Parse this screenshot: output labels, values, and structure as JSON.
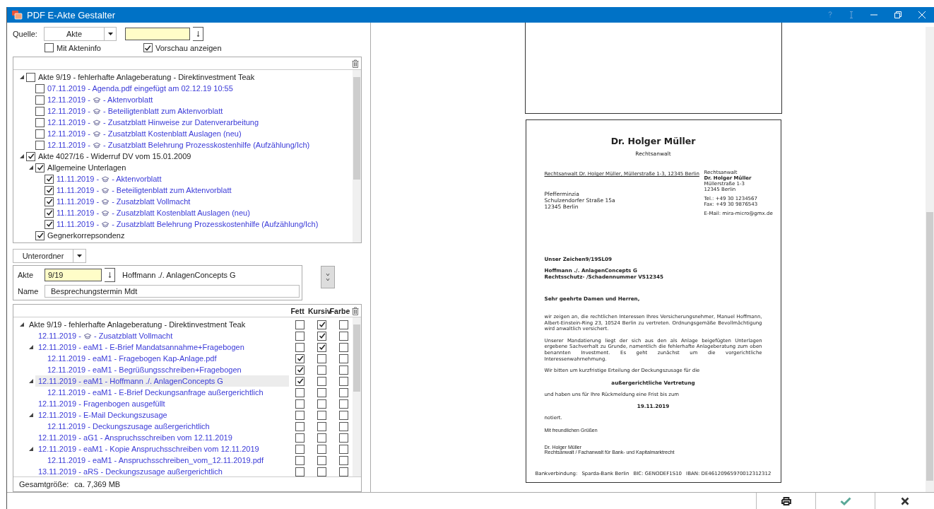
{
  "window": {
    "title": "PDF E-Akte Gestalter"
  },
  "source": {
    "label": "Quelle:",
    "dropdown": "Akte",
    "options": [
      {
        "label": "Mit Akteninfo",
        "checked": false
      },
      {
        "label": "Vorschau anzeigen",
        "checked": true
      }
    ]
  },
  "tree1": {
    "items": [
      {
        "kind": "folder",
        "label": "Akte 9/19 - fehlerhafte Anlageberatung - Direktinvestment Teak",
        "checked": false,
        "expanded": true,
        "children": [
          {
            "kind": "document",
            "label": "07.11.2019 - Agenda.pdf  eingefügt am 02.12.19 10:55",
            "checked": false
          },
          {
            "kind": "document",
            "label": "12.11.2019 -",
            "suffix": "- Aktenvorblatt",
            "checked": false
          },
          {
            "kind": "document",
            "label": "12.11.2019 -",
            "suffix": "- Beteiligtenblatt zum Aktenvorblatt",
            "checked": false
          },
          {
            "kind": "document",
            "label": "12.11.2019 -",
            "suffix": "- Zusatzblatt Hinweise zur Datenverarbeitung",
            "checked": false
          },
          {
            "kind": "document",
            "label": "12.11.2019 -",
            "suffix": "- Zusatzblatt Kostenblatt Auslagen (neu)",
            "checked": false
          },
          {
            "kind": "document",
            "label": "12.11.2019 -",
            "suffix": "- Zusatzblatt Belehrung Prozesskostenhilfe (Aufzählung/Ich)",
            "checked": false
          }
        ]
      },
      {
        "kind": "folder",
        "label": "Akte 4027/16 - Widerruf DV vom 15.01.2009",
        "checked": true,
        "expanded": true,
        "children": [
          {
            "kind": "folder",
            "label": "Allgemeine Unterlagen",
            "checked": true,
            "expanded": true,
            "children": [
              {
                "kind": "document",
                "label": "11.11.2019 -",
                "suffix": "- Aktenvorblatt",
                "checked": true
              },
              {
                "kind": "document",
                "label": "11.11.2019 -",
                "suffix": "- Beteiligtenblatt zum Aktenvorblatt",
                "checked": true
              },
              {
                "kind": "document",
                "label": "11.11.2019 -",
                "suffix": "- Zusatzblatt Vollmacht",
                "checked": true
              },
              {
                "kind": "document",
                "label": "11.11.2019 -",
                "suffix": "- Zusatzblatt Kostenblatt Auslagen (neu)",
                "checked": true
              },
              {
                "kind": "document",
                "label": "11.11.2019 -",
                "suffix": "- Zusatzblatt Belehrung Prozesskostenhilfe (Aufzählung/Ich)",
                "checked": true
              }
            ]
          },
          {
            "kind": "folder",
            "label": "Gegnerkorrepsondenz",
            "checked": true
          }
        ]
      }
    ]
  },
  "subfolder": {
    "dropdown": "Unterordner",
    "akte_label": "Akte",
    "akte_value": "9/19",
    "akte_name": "Hoffmann ./. AnlagenConcepts G",
    "name_label": "Name",
    "name_value": "Besprechungstermin Mdt"
  },
  "tree2": {
    "columns": [
      "Fett",
      "Kursiv",
      "Farbe"
    ],
    "items": [
      {
        "kind": "folder",
        "label": "Akte 9/19 - fehlerhafte Anlageberatung - Direktinvestment Teak",
        "expanded": true,
        "selected": false,
        "fett": false,
        "kursiv": true,
        "farbe": false,
        "children": [
          {
            "kind": "document",
            "label": "12.11.2019 -",
            "suffix": "- Zusatzblatt Vollmacht",
            "selected": false,
            "fett": false,
            "kursiv": true,
            "farbe": false
          },
          {
            "kind": "document",
            "label": "12.11.2019 - eaM1 - E-Brief Mandatsannahme+Fragebogen",
            "expanded": true,
            "selected": false,
            "fett": false,
            "kursiv": true,
            "farbe": false,
            "children": [
              {
                "kind": "document",
                "label": "12.11.2019 - eaM1 - Fragebogen Kap-Anlage.pdf",
                "selected": false,
                "fett": true,
                "kursiv": false,
                "farbe": false
              },
              {
                "kind": "document",
                "label": "12.11.2019 - eaM1 - Begrüßungsschreiben+Fragebogen",
                "selected": false,
                "fett": true,
                "kursiv": false,
                "farbe": false
              }
            ]
          },
          {
            "kind": "document",
            "label": "12.11.2019 - eaM1 - Hoffmann ./. AnlagenConcepts G",
            "expanded": true,
            "selected": true,
            "fett": true,
            "kursiv": false,
            "farbe": false,
            "children": [
              {
                "kind": "document",
                "label": "12.11.2019 - eaM1 - E-Brief Deckungsanfrage außergerichtlich",
                "selected": false,
                "fett": false,
                "kursiv": false,
                "farbe": false
              }
            ]
          },
          {
            "kind": "document",
            "label": "12.11.2019 - Fragenbogen ausgefüllt",
            "selected": false,
            "fett": false,
            "kursiv": false,
            "farbe": false
          },
          {
            "kind": "document",
            "label": "12.11.2019 - E-Mail Deckungszusage",
            "expanded": true,
            "selected": false,
            "fett": false,
            "kursiv": false,
            "farbe": false,
            "children": [
              {
                "kind": "document",
                "label": "12.11.2019 - Deckungszusage außergerichtlich",
                "selected": false,
                "fett": false,
                "kursiv": false,
                "farbe": false
              }
            ]
          },
          {
            "kind": "document",
            "label": "12.11.2019 - aG1 - Anspruchsschreiben vom 12.11.2019",
            "selected": false,
            "fett": false,
            "kursiv": false,
            "farbe": false
          },
          {
            "kind": "document",
            "label": "12.11.2019 - eaM1 - Kopie Anspruchsschreiben vom 12.11.2019",
            "expanded": true,
            "selected": false,
            "fett": false,
            "kursiv": false,
            "farbe": false,
            "children": [
              {
                "kind": "document",
                "label": "12.11.2019 - eaM1 - Anspruchsschreiben_vom_12.11.2019.pdf",
                "selected": false,
                "fett": false,
                "kursiv": false,
                "farbe": false
              }
            ]
          },
          {
            "kind": "document",
            "label": "13.11.2019 - aRS - Deckungszusage außergerichtlich",
            "selected": false,
            "fett": false,
            "kursiv": false,
            "farbe": false
          }
        ]
      }
    ]
  },
  "total": {
    "label": "Gesamtgröße:",
    "value": "ca. 7,369 MB"
  },
  "letter": {
    "heading": "Dr. Holger Müller",
    "subheading": "Rechtsanwalt",
    "sender_line": "Rechtsanwalt Dr. Holger Müller, Müllerstraße 1-3, 12345 Berlin",
    "sender_block": [
      {
        "text": "Rechtsanwalt",
        "bold": false
      },
      {
        "text": "Dr. Holger Müller",
        "bold": true
      },
      {
        "text": "Müllerstraße 1-3",
        "bold": false
      },
      {
        "text": "12345 Berlin",
        "bold": false
      }
    ],
    "contact": [
      "Tel.: +49 30 1234567",
      "Fax: +49 30 9876543"
    ],
    "email": "E-Mail: mira-micro@gmx.de",
    "recipient": [
      "Pfefferminzia",
      "Schulzendorfer Straße 15a",
      "12345 Berlin"
    ],
    "reference": "Unser Zeichen9/19SL09",
    "subject": [
      "Hoffmann ./. AnlagenConcepts G",
      "Rechtsschutz- /Schadennummer VS12345"
    ],
    "salutation": "Sehr geehrte Damen und Herren,",
    "body": [
      {
        "kind": "paragraph",
        "text": "wir zeigen an, die rechtlichen Interessen Ihres Versicherungsnehmer, Manuel Hoffmann, Albert-Einstein-Ring 23, 10524 Berlin zu vertreten. Ordnungsgemäße Bevollmächtigung wird anwaltlich versichert."
      },
      {
        "kind": "paragraph",
        "text": "Unserer Mandatierung liegt der sich aus den als Anlage beigefügten Unterlagen ergebene Sachverhalt zu Grunde, namentlich die fehlerhafte Anlageberatung zum oben benannten Investment. Es geht zunächst um die vorgerichtliche Interessenwahrnehmung."
      },
      {
        "kind": "paragraph",
        "text": "Wir bitten um kurzfristige Erteilung der Deckungszusage für die"
      },
      {
        "kind": "centered",
        "text": "außergerichtliche Vertretung"
      },
      {
        "kind": "paragraph",
        "text": "und haben uns für Ihre Rückmeldung eine Frist bis zum"
      },
      {
        "kind": "centered",
        "text": "19.11.2019"
      },
      {
        "kind": "paragraph",
        "text": "notiert."
      }
    ],
    "closing": "Mit freundlichen Grüßen",
    "signature": [
      "Dr. Holger Müller",
      "Rechtsanwalt / Fachanwalt für Bank- und Kapitalmarktrecht"
    ],
    "footer": [
      "Bankverbindung:",
      "Sparda-Bank Berlin",
      "BIC: GENODEF1S10",
      "IBAN: DE46120965970012312312"
    ]
  }
}
